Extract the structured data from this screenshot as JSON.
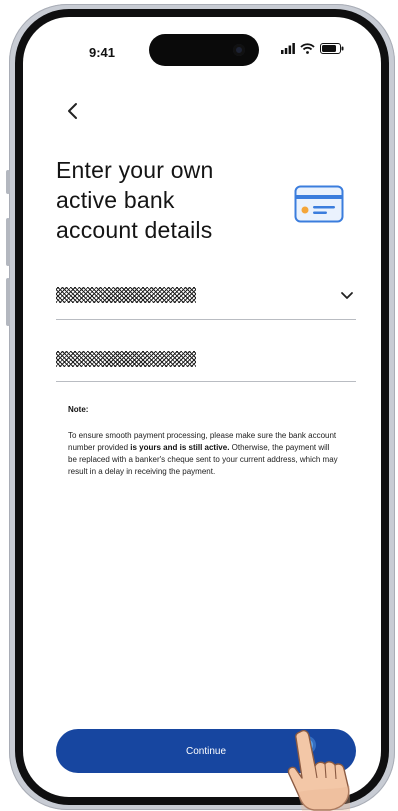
{
  "status_bar": {
    "time": "9:41",
    "icons": [
      "signal-icon",
      "wifi-icon",
      "battery-icon"
    ]
  },
  "nav": {
    "back_icon": "chevron-left-icon"
  },
  "title": "Enter your own active bank account details",
  "title_lines": [
    "Enter your own",
    "active bank",
    "account details"
  ],
  "illustration": "bank-card-icon",
  "form": {
    "bank_select": {
      "value": "[redacted]",
      "icon": "chevron-down-icon"
    },
    "account_number": {
      "value": "[redacted]"
    }
  },
  "note": {
    "heading": "Note:",
    "text_1": "To ensure smooth payment processing, please make sure the bank account number provided ",
    "bold_1": "is yours and is still active.",
    "text_2": " Otherwise, the payment will be replaced with a banker's cheque sent to your current address, which may result in a delay in receiving the payment."
  },
  "continue_button": {
    "label": "Continue"
  },
  "colors": {
    "primary": "#1746a0",
    "card_icon_blue": "#3b7ddd",
    "card_icon_orange": "#f4a63a",
    "text": "#141414"
  }
}
